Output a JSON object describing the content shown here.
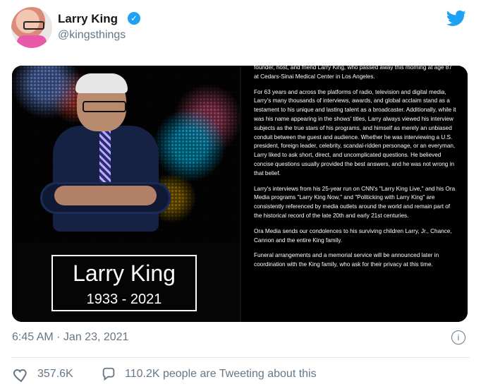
{
  "tweet": {
    "author_name": "Larry King",
    "author_handle": "@kingsthings",
    "timestamp": "6:45 AM · Jan 23, 2021",
    "likes": "357.6K",
    "tweeting_count": "110.2K people are Tweeting about this"
  },
  "media": {
    "caption_title": "Larry King",
    "caption_years": "1933 - 2021",
    "statement": [
      "founder, host, and friend Larry King, who passed away this morning at age 87 at Cedars-Sinai Medical Center in Los Angeles.",
      "For 63 years and across the platforms of radio, television and digital media, Larry's many thousands of interviews, awards, and global acclaim stand as a testament to his unique and lasting talent as a broadcaster. Additionally, while it was his name appearing in the shows' titles, Larry always viewed his interview subjects as the true stars of his programs, and himself as merely an unbiased conduit between the guest and audience. Whether he was interviewing a U.S. president, foreign leader, celebrity, scandal-ridden personage, or an everyman, Larry liked to ask short, direct, and uncomplicated questions. He believed concise questions usually provided the best answers, and he was not wrong in that belief.",
      "Larry's interviews from his 25-year run on CNN's \"Larry King Live,\" and his Ora Media programs \"Larry King Now,\" and \"Politicking with Larry King\" are consistently referenced by media outlets around the world and remain part of the historical record of the late 20th and early 21st centuries.",
      "Ora Media sends our condolences to his surviving children Larry, Jr., Chance, Cannon and the entire King family.",
      "Funeral arrangements and a memorial service will be announced later in coordination with the King family, who ask for their privacy at this time."
    ]
  },
  "icons": {
    "brand": "twitter-bird-icon",
    "verified": "verified-badge-icon",
    "info": "info-icon",
    "like": "heart-icon",
    "reply": "chat-bubble-icon"
  },
  "colors": {
    "twitter_blue": "#1da1f2",
    "meta_gray": "#657786",
    "text": "#14171a"
  }
}
